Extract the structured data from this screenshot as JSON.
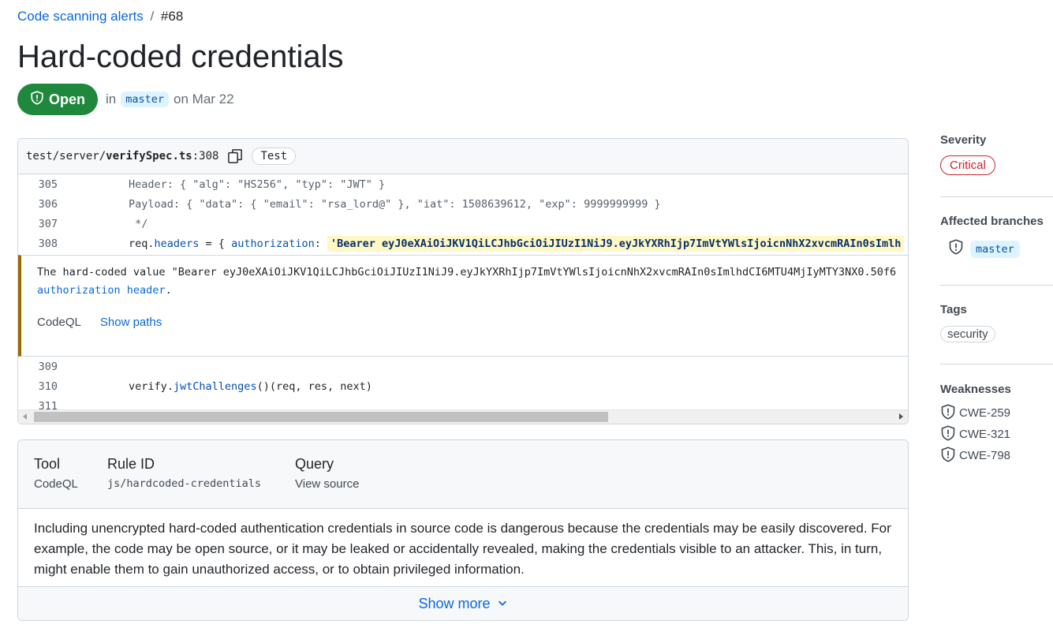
{
  "breadcrumb": {
    "parent": "Code scanning alerts",
    "separator": "/",
    "current": "#68"
  },
  "title": "Hard-coded credentials",
  "status": {
    "label": "Open",
    "in_text": "in",
    "branch": "master",
    "date_text": "on Mar 22",
    "color": "#1f883d"
  },
  "code_panel": {
    "file_prefix": "test/server/",
    "file_name": "verifySpec.ts",
    "line_ref": ":308",
    "tag": "Test",
    "lines_before": [
      {
        "num": "305",
        "text": "Header: { \"alg\": \"HS256\", \"typ\": \"JWT\" }"
      },
      {
        "num": "306",
        "text": "Payload: { \"data\": { \"email\": \"rsa_lord@\" }, \"iat\": 1508639612, \"exp\": 9999999999 }"
      },
      {
        "num": "307",
        "text": " */"
      }
    ],
    "line_308": {
      "num": "308",
      "obj": "req.",
      "prop": "headers",
      "mid": " = { ",
      "key": "authorization",
      "colon": ": ",
      "value": "'Bearer eyJ0eXAiOiJKV1QiLCJhbGciOiJIUzI1NiJ9.eyJkYXRhIjp7ImVtYWlsIjoicnNhX2xvcmRAIn0sImlh"
    },
    "alert": {
      "message": "The hard-coded value \"Bearer eyJ0eXAiOiJKV1QiLCJhbGciOiJIUzI1NiJ9.eyJkYXRhIjp7ImVtYWlsIjoicnNhX2xvcmRAIn0sImlhdCI6MTU4MjIyMTY3NX0.50f6",
      "link": "authorization header",
      "suffix": ".",
      "tool": "CodeQL",
      "show_paths": "Show paths"
    },
    "lines_after": [
      {
        "num": "309",
        "obj": "",
        "fn": "",
        "rest": ""
      },
      {
        "num": "310",
        "obj": "verify.",
        "fn": "jwtChallenges",
        "rest": "()(req, res, next)"
      },
      {
        "num": "311",
        "obj": "",
        "fn": "",
        "rest": ""
      }
    ]
  },
  "rule": {
    "tool_label": "Tool",
    "tool_value": "CodeQL",
    "rule_id_label": "Rule ID",
    "rule_id_value": "js/hardcoded-credentials",
    "query_label": "Query",
    "query_value": "View source",
    "description": "Including unencrypted hard-coded authentication credentials in source code is dangerous because the credentials may be easily discovered. For example, the code may be open source, or it may be leaked or accidentally revealed, making the credentials visible to an attacker. This, in turn, might enable them to gain unauthorized access, or to obtain privileged information.",
    "show_more": "Show more"
  },
  "sidebar": {
    "severity_heading": "Severity",
    "severity_value": "Critical",
    "severity_color": "#cf222e",
    "branches_heading": "Affected branches",
    "branch": "master",
    "tags_heading": "Tags",
    "tag": "security",
    "weaknesses_heading": "Weaknesses",
    "weaknesses": [
      "CWE-259",
      "CWE-321",
      "CWE-798"
    ]
  }
}
